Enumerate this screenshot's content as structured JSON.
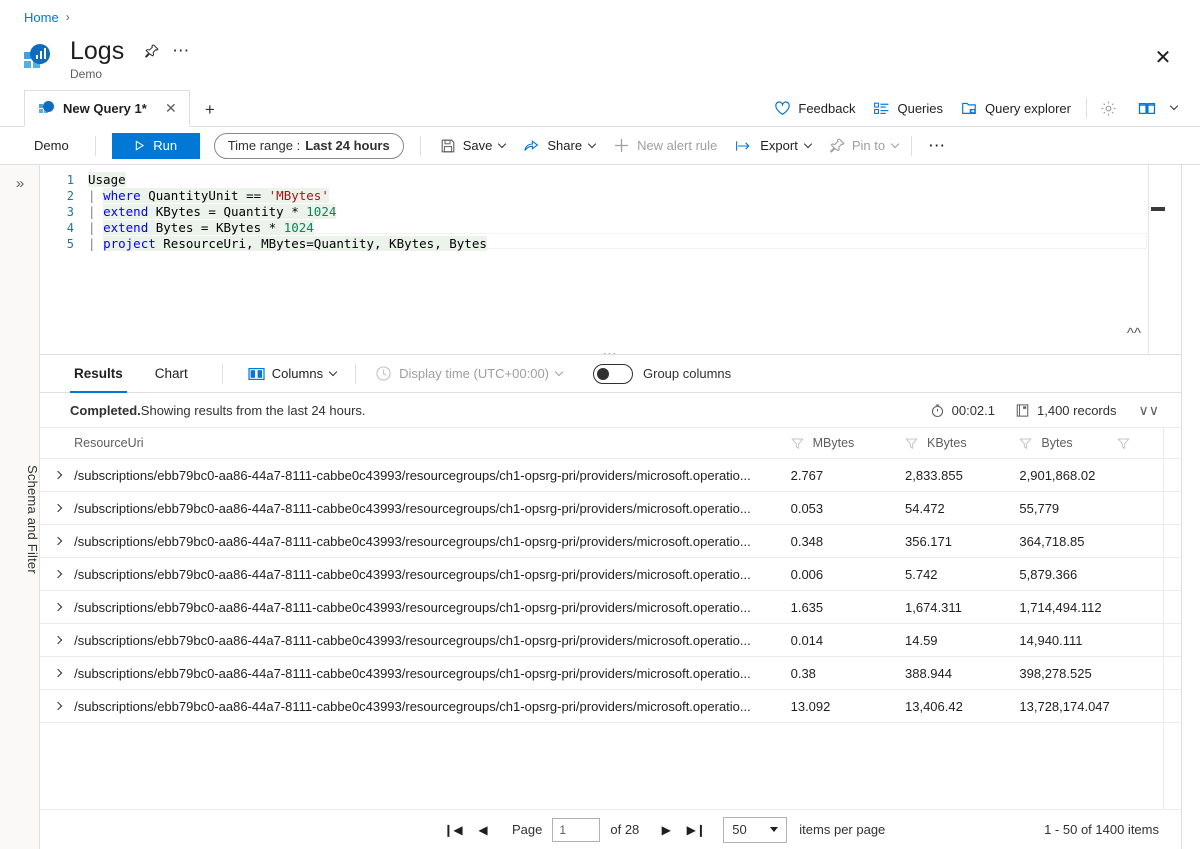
{
  "breadcrumb": {
    "home": "Home",
    "separator": "›"
  },
  "header": {
    "title": "Logs",
    "subtitle": "Demo",
    "pin_icon": "pin-icon",
    "more_icon": "ellipsis-icon",
    "close_icon": "close-icon",
    "accent": "#0078d4"
  },
  "tabs": {
    "items": [
      {
        "label": "New Query 1*",
        "close": "✕"
      }
    ],
    "add_label": "+"
  },
  "top_commands": [
    {
      "label": "Feedback",
      "icon": "heart-icon"
    },
    {
      "label": "Queries",
      "icon": "list-icon"
    },
    {
      "label": "Query explorer",
      "icon": "folder-arrow-icon"
    }
  ],
  "top_icon_commands": [
    {
      "icon": "gear-icon"
    },
    {
      "icon": "book-icon"
    }
  ],
  "querybar": {
    "scope": "Demo",
    "run_label": "Run",
    "time_range_label": "Time range :",
    "time_range_value": "Last 24 hours",
    "commands": [
      {
        "label": "Save",
        "icon": "save-icon",
        "caret": true,
        "disabled": false
      },
      {
        "label": "Share",
        "icon": "share-icon",
        "caret": true,
        "disabled": false
      },
      {
        "label": "New alert rule",
        "icon": "plus-icon",
        "caret": false,
        "disabled": true
      },
      {
        "label": "Export",
        "icon": "export-icon",
        "caret": true,
        "disabled": false
      },
      {
        "label": "Pin to",
        "icon": "pin-icon",
        "caret": true,
        "disabled": true
      }
    ],
    "more_label": "⋯"
  },
  "left_rail": {
    "expand_icon": "double-chevron-right-icon",
    "label": "Schema and Filter"
  },
  "editor": {
    "lines": [
      {
        "no": "1",
        "text": "Usage"
      },
      {
        "no": "2",
        "text": "| where QuantityUnit == 'MBytes'"
      },
      {
        "no": "3",
        "text": "| extend KBytes = Quantity * 1024"
      },
      {
        "no": "4",
        "text": "| extend Bytes = KBytes * 1024"
      },
      {
        "no": "5",
        "text": "| project ResourceUri, MBytes=Quantity, KBytes, Bytes"
      }
    ],
    "collapse_icon": "double-chevron-up-icon",
    "drag_handle": "⋯"
  },
  "results": {
    "tabs": [
      {
        "label": "Results",
        "active": true
      },
      {
        "label": "Chart",
        "active": false
      }
    ],
    "columns_label": "Columns",
    "columns_icon": "columns-icon",
    "display_time_label": "Display time (UTC+00:00)",
    "display_time_icon": "clock-icon",
    "group_columns_label": "Group columns",
    "group_columns_on": false,
    "status_bold": "Completed.",
    "status_text": " Showing results from the last 24 hours.",
    "duration": "00:02.1",
    "duration_icon": "timer-icon",
    "records": "1,400 records",
    "records_icon": "records-icon",
    "expand_icon": "double-chevron-down-icon"
  },
  "table": {
    "columns": [
      "ResourceUri",
      "MBytes",
      "KBytes",
      "Bytes"
    ],
    "filter_icon": "filter-funnel-icon",
    "expand_row_icon": "chevron-right-icon",
    "rows": [
      {
        "uri": "/subscriptions/ebb79bc0-aa86-44a7-8111-cabbe0c43993/resourcegroups/ch1-opsrg-pri/providers/microsoft.operatio...",
        "mbytes": "2.767",
        "kbytes": "2,833.855",
        "bytes": "2,901,868.02"
      },
      {
        "uri": "/subscriptions/ebb79bc0-aa86-44a7-8111-cabbe0c43993/resourcegroups/ch1-opsrg-pri/providers/microsoft.operatio...",
        "mbytes": "0.053",
        "kbytes": "54.472",
        "bytes": "55,779"
      },
      {
        "uri": "/subscriptions/ebb79bc0-aa86-44a7-8111-cabbe0c43993/resourcegroups/ch1-opsrg-pri/providers/microsoft.operatio...",
        "mbytes": "0.348",
        "kbytes": "356.171",
        "bytes": "364,718.85"
      },
      {
        "uri": "/subscriptions/ebb79bc0-aa86-44a7-8111-cabbe0c43993/resourcegroups/ch1-opsrg-pri/providers/microsoft.operatio...",
        "mbytes": "0.006",
        "kbytes": "5.742",
        "bytes": "5,879.366"
      },
      {
        "uri": "/subscriptions/ebb79bc0-aa86-44a7-8111-cabbe0c43993/resourcegroups/ch1-opsrg-pri/providers/microsoft.operatio...",
        "mbytes": "1.635",
        "kbytes": "1,674.311",
        "bytes": "1,714,494.112"
      },
      {
        "uri": "/subscriptions/ebb79bc0-aa86-44a7-8111-cabbe0c43993/resourcegroups/ch1-opsrg-pri/providers/microsoft.operatio...",
        "mbytes": "0.014",
        "kbytes": "14.59",
        "bytes": "14,940.111"
      },
      {
        "uri": "/subscriptions/ebb79bc0-aa86-44a7-8111-cabbe0c43993/resourcegroups/ch1-opsrg-pri/providers/microsoft.operatio...",
        "mbytes": "0.38",
        "kbytes": "388.944",
        "bytes": "398,278.525"
      },
      {
        "uri": "/subscriptions/ebb79bc0-aa86-44a7-8111-cabbe0c43993/resourcegroups/ch1-opsrg-pri/providers/microsoft.operatio...",
        "mbytes": "13.092",
        "kbytes": "13,406.42",
        "bytes": "13,728,174.047"
      }
    ]
  },
  "pager": {
    "first_icon": "❙◀",
    "prev_icon": "◀",
    "next_icon": "▶",
    "last_icon": "▶❙",
    "page_label": "Page",
    "page_value": "1",
    "of_label": "of 28",
    "page_size": "50",
    "items_per_page_label": "items per page",
    "range_text": "1 - 50 of 1400 items"
  }
}
